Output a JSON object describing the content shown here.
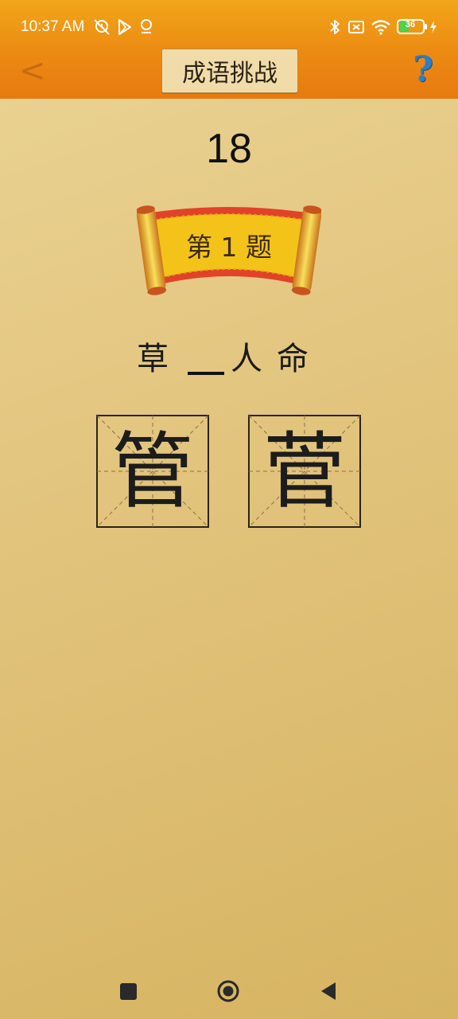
{
  "status_bar": {
    "time": "10:37 AM",
    "battery": "36",
    "icons": [
      "alarm-off-icon",
      "play-store-icon",
      "location-icon",
      "bluetooth-icon",
      "sim-off-icon",
      "wifi-icon",
      "battery-icon",
      "charging-icon"
    ]
  },
  "header": {
    "back_label": "<",
    "title": "成语挑战",
    "help_label": "?"
  },
  "game": {
    "timer": "18",
    "question_label": "第 1 题",
    "idiom": {
      "chars": [
        "草",
        "人",
        "命"
      ],
      "blank": "__"
    },
    "choices": [
      "管",
      "菅"
    ]
  },
  "colors": {
    "header_orange": "#ec8a12",
    "background_tan": "#e2c47d",
    "scroll_red": "#e1422a",
    "scroll_gold": "#f3c31a",
    "help_blue": "#2f7ec6"
  },
  "navigation_bar": {
    "icons": [
      "recent-apps-icon",
      "home-icon",
      "back-triangle-icon"
    ]
  }
}
